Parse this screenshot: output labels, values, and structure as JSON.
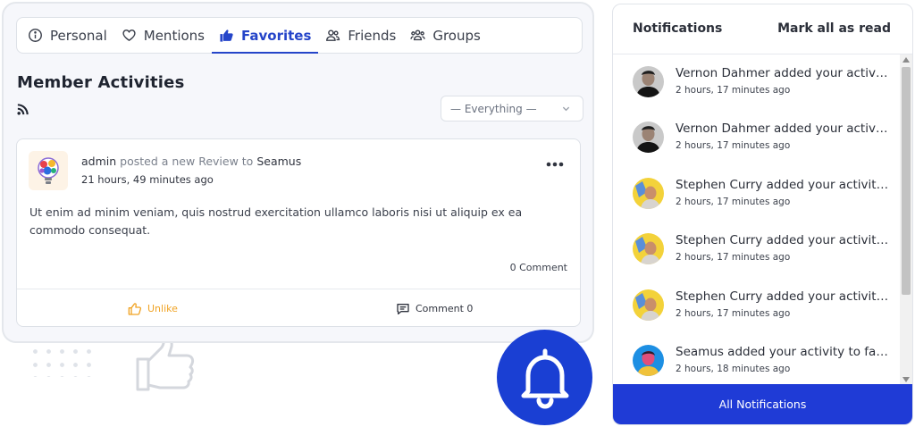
{
  "tabs": [
    {
      "label": "Personal",
      "icon": "info-circle-icon"
    },
    {
      "label": "Mentions",
      "icon": "heart-icon"
    },
    {
      "label": "Favorites",
      "icon": "thumbs-up-icon",
      "active": true
    },
    {
      "label": "Friends",
      "icon": "users-icon"
    },
    {
      "label": "Groups",
      "icon": "group-icon"
    }
  ],
  "section": {
    "title": "Member Activities",
    "filter_value": "— Everything —"
  },
  "activity": {
    "author": "admin",
    "action_text": "posted a new Review to",
    "target": "Seamus",
    "time": "21 hours, 49 minutes ago",
    "body": "Ut enim ad minim veniam, quis nostrud exercitation ullamco laboris nisi ut aliquip ex ea commodo consequat.",
    "comment_count_text": "0 Comment",
    "unlike_label": "Unlike",
    "comment_label": "Comment 0"
  },
  "notifications": {
    "title": "Notifications",
    "mark_all_label": "Mark all as read",
    "items": [
      {
        "text": "Vernon Dahmer added your activity to favorites",
        "time": "2 hours, 17 minutes ago",
        "avatar": "dark"
      },
      {
        "text": "Vernon Dahmer added your activity to favorites",
        "time": "2 hours, 17 minutes ago",
        "avatar": "dark"
      },
      {
        "text": "Stephen Curry added your activity to favorites",
        "time": "2 hours, 17 minutes ago",
        "avatar": "yellow"
      },
      {
        "text": "Stephen Curry added your activity to favorites",
        "time": "2 hours, 17 minutes ago",
        "avatar": "yellow"
      },
      {
        "text": "Stephen Curry added your activity to favorites",
        "time": "2 hours, 17 minutes ago",
        "avatar": "yellow"
      },
      {
        "text": "Seamus added your activity to favorites",
        "time": "2 hours, 18 minutes ago",
        "avatar": "blue"
      }
    ],
    "all_label": "All Notifications"
  },
  "colors": {
    "accent": "#1f3bd6",
    "active_tab": "#2545c9",
    "unlike": "#f0a324"
  }
}
